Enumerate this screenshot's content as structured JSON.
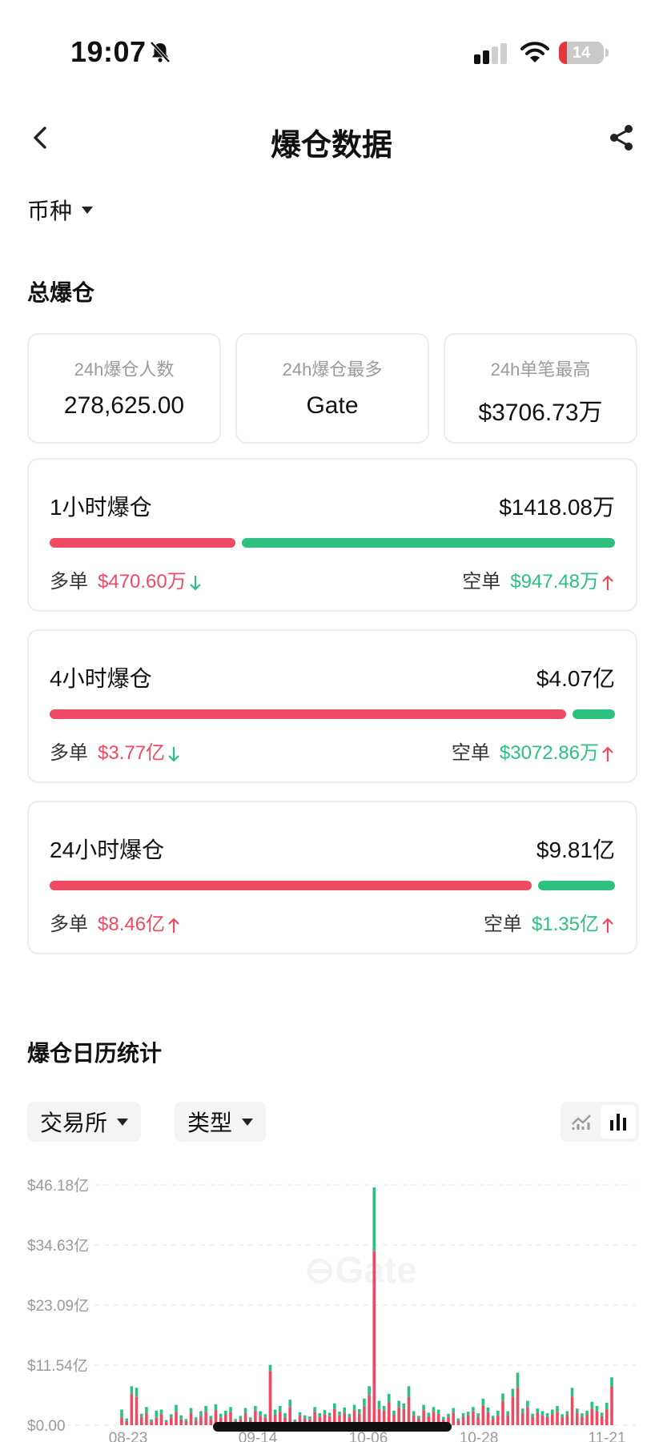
{
  "status_bar": {
    "time": "19:07",
    "icons": [
      "bell-off-icon",
      "signal-icon",
      "wifi-icon",
      "battery-icon"
    ],
    "battery": "14"
  },
  "nav": {
    "title": "爆仓数据",
    "icons": [
      "chevron-left-icon",
      "share-icon"
    ]
  },
  "filters": {
    "coin": "币种"
  },
  "summary": {
    "title": "总爆仓",
    "stats": [
      {
        "label": "24h爆仓人数",
        "value": "278,625.00"
      },
      {
        "label": "24h爆仓最多",
        "value": "Gate"
      },
      {
        "label": "24h单笔最高",
        "value": "$3706.73万"
      }
    ],
    "periods": [
      {
        "title": "1小时爆仓",
        "total": "$1418.08万",
        "long_label": "多单",
        "long_value": "$470.60万",
        "long_trend": "down",
        "short_label": "空单",
        "short_value": "$947.48万",
        "short_trend": "up",
        "long_fraction": 0.3319
      },
      {
        "title": "4小时爆仓",
        "total": "$4.07亿",
        "long_label": "多单",
        "long_value": "$3.77亿",
        "long_trend": "down",
        "short_label": "空单",
        "short_value": "$3072.86万",
        "short_trend": "up",
        "long_fraction": 0.9245
      },
      {
        "title": "24小时爆仓",
        "total": "$9.81亿",
        "long_label": "多单",
        "long_value": "$8.46亿",
        "long_trend": "up",
        "short_label": "空单",
        "short_value": "$1.35亿",
        "short_trend": "up",
        "long_fraction": 0.8624
      }
    ]
  },
  "calendar": {
    "title": "爆仓日历统计",
    "exchange_filter": "交易所",
    "type_filter": "类型",
    "view_toggle": {
      "icons": [
        "line-chart-icon",
        "bar-chart-icon"
      ],
      "active": "bar"
    }
  },
  "chart_data": {
    "type": "bar",
    "stacked": true,
    "yticks": [
      "$0.00",
      "$11.54亿",
      "$23.09亿",
      "$34.63亿",
      "$46.18亿"
    ],
    "ylim": [
      0,
      46.18
    ],
    "xticks": [
      "08-23",
      "09-14",
      "10-06",
      "10-28",
      "11-21"
    ],
    "grid": true,
    "colors": {
      "long": "#ee4b62",
      "short": "#2ec07f"
    },
    "series": [
      {
        "values": [
          1.5,
          0.8,
          6.0,
          5.4,
          1.6,
          2.3,
          0.7,
          1.4,
          2.1,
          0.6,
          1.5,
          2.6,
          1.1,
          0.8,
          2.4,
          0.9,
          1.7,
          2.6,
          1.2,
          2.9,
          1.4,
          2.0,
          2.5,
          0.8,
          1.2,
          2.3,
          1.0,
          2.8,
          1.8,
          1.5,
          10.4,
          2.0,
          2.6,
          1.5,
          3.5,
          0.8,
          1.9,
          1.3,
          1.1,
          2.6,
          1.6,
          2.1,
          1.8,
          3.1,
          1.9,
          2.4,
          1.6,
          2.9,
          2.2,
          3.6,
          5.8,
          33.5,
          3.1,
          2.8,
          4.4,
          2.0,
          3.4,
          3.1,
          5.4,
          1.9,
          1.3,
          2.9,
          1.7,
          2.6,
          2.2,
          1.1,
          1.6,
          2.4,
          0.9,
          1.6,
          1.9,
          2.6,
          1.6,
          3.8,
          2.5,
          1.3,
          1.9,
          4.6,
          1.9,
          5.5,
          7.2,
          2.3,
          3.5,
          1.6,
          2.4,
          1.9,
          1.6,
          2.1,
          2.6,
          1.5,
          2.0,
          5.5,
          2.4,
          1.6,
          2.0,
          3.2,
          2.7,
          1.7,
          3.0,
          7.4
        ]
      },
      {
        "values": [
          1.5,
          0.5,
          1.5,
          1.8,
          0.6,
          1.2,
          0.4,
          1.4,
          0.9,
          0.4,
          0.6,
          1.3,
          0.8,
          0.4,
          0.9,
          0.6,
          1.0,
          1.1,
          0.6,
          1.1,
          0.8,
          0.8,
          1.0,
          0.4,
          0.6,
          1.0,
          0.5,
          0.9,
          0.9,
          0.6,
          1.2,
          1.0,
          1.1,
          0.8,
          1.4,
          0.3,
          0.6,
          0.6,
          0.6,
          0.9,
          0.7,
          0.8,
          0.6,
          1.1,
          0.7,
          1.0,
          0.6,
          1.0,
          0.9,
          1.5,
          1.7,
          12.2,
          1.6,
          0.9,
          1.6,
          0.8,
          1.3,
          1.1,
          2.1,
          0.8,
          0.5,
          1.0,
          0.7,
          0.9,
          0.8,
          0.5,
          0.6,
          0.9,
          0.4,
          0.7,
          0.7,
          0.9,
          0.7,
          1.3,
          0.9,
          0.5,
          0.9,
          1.5,
          0.8,
          1.5,
          2.9,
          0.9,
          1.2,
          0.6,
          0.8,
          0.8,
          0.7,
          0.9,
          1.1,
          0.6,
          0.7,
          1.7,
          0.8,
          0.7,
          0.8,
          1.3,
          1.0,
          0.7,
          1.3,
          1.8
        ]
      }
    ]
  }
}
